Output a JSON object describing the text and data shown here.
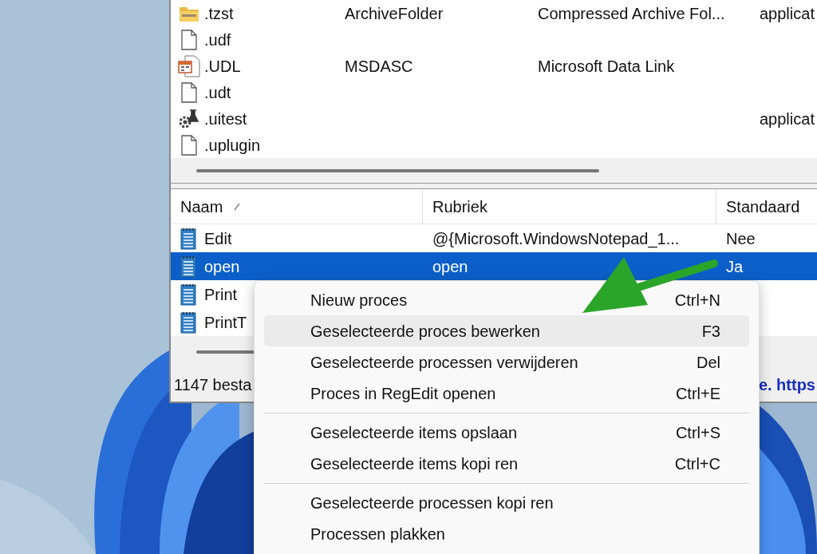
{
  "file_types": [
    {
      "kind": "zip-folder",
      "name": ".tzst",
      "type": "ArchiveFolder",
      "description": "Compressed Archive Fol...",
      "column_4": "applicat"
    },
    {
      "kind": "blank",
      "name": ".udf"
    },
    {
      "kind": "data-link",
      "name": ".UDL",
      "type": "MSDASC",
      "description": "Microsoft Data Link"
    },
    {
      "kind": "blank",
      "name": ".udt"
    },
    {
      "kind": "gear-flask",
      "name": ".uitest",
      "column_4": "applicat"
    },
    {
      "kind": "blank",
      "name": ".uplugin"
    }
  ],
  "process_table": {
    "columns": [
      {
        "label": "Naam",
        "sorted": true
      },
      {
        "label": "Rubriek",
        "sorted": false
      },
      {
        "label": "Standaard",
        "sorted": false
      }
    ],
    "rows": [
      {
        "name": "Edit",
        "rubriek": "@{Microsoft.WindowsNotepad_1...",
        "standaard": "Nee",
        "selected": false
      },
      {
        "name": "open",
        "rubriek": "open",
        "standaard": "Ja",
        "selected": true
      },
      {
        "name": "Print",
        "selected": false
      },
      {
        "name": "PrintT",
        "selected": false
      }
    ]
  },
  "status_bar": {
    "count": "1147 besta",
    "link": "e. https"
  },
  "context_menu": [
    {
      "kind": "item",
      "label": "Nieuw proces",
      "shortcut": "Ctrl+N",
      "highlighted": false
    },
    {
      "kind": "item",
      "label": "Geselecteerde proces bewerken",
      "shortcut": "F3",
      "highlighted": true
    },
    {
      "kind": "item",
      "label": "Geselecteerde processen verwijderen",
      "shortcut": "Del",
      "highlighted": false
    },
    {
      "kind": "item",
      "label": "Proces in RegEdit openen",
      "shortcut": "Ctrl+E",
      "highlighted": false
    },
    {
      "kind": "separator"
    },
    {
      "kind": "item",
      "label": "Geselecteerde items opslaan",
      "shortcut": "Ctrl+S",
      "highlighted": false
    },
    {
      "kind": "item",
      "label": "Geselecteerde items kopi ren",
      "shortcut": "Ctrl+C",
      "highlighted": false
    },
    {
      "kind": "separator"
    },
    {
      "kind": "item",
      "label": "Geselecteerde processen kopi ren",
      "highlighted": false
    },
    {
      "kind": "item",
      "label": "Processen plakken",
      "highlighted": false
    }
  ]
}
